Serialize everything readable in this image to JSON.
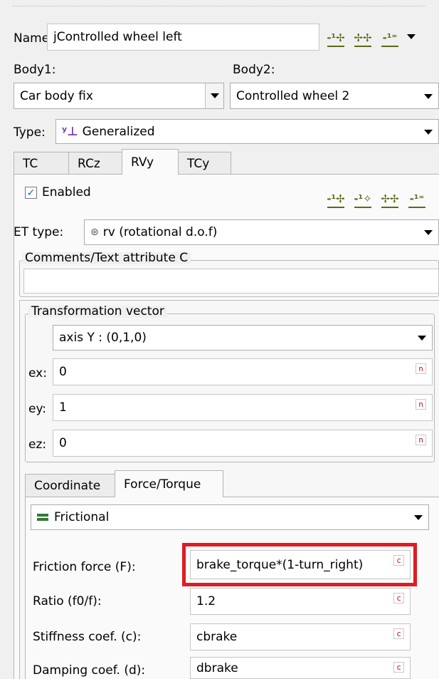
{
  "header": {
    "name_label": "Name",
    "name_value": "jControlled wheel left",
    "toolbar_icons": [
      "insert-before-icon",
      "insert-after-icon",
      "delete-icon",
      "more-chevron-icon"
    ]
  },
  "bodies": {
    "body1_label": "Body1:",
    "body1_value": "Car body fix",
    "body2_label": "Body2:",
    "body2_value": "Controlled wheel 2"
  },
  "type": {
    "label": "Type:",
    "value": "Generalized"
  },
  "tabs": [
    {
      "label": "TC",
      "active": false
    },
    {
      "label": "RCz",
      "active": false
    },
    {
      "label": "RVy",
      "active": true
    },
    {
      "label": "TCy",
      "active": false
    }
  ],
  "element": {
    "enabled_label": "Enabled",
    "enabled_checked": true,
    "et_type_label": "ET type:",
    "et_type_value": "rv (rotational d.o.f)",
    "comments_label": "Comments/Text attribute C",
    "comments_value": ""
  },
  "transformation": {
    "title": "Transformation vector",
    "axis_value": "axis Y : (0,1,0)",
    "rows": [
      {
        "label": "ex:",
        "value": "0"
      },
      {
        "label": "ey:",
        "value": "1"
      },
      {
        "label": "ez:",
        "value": "0"
      }
    ],
    "unit_glyph": "n"
  },
  "subtabs": [
    {
      "label": "Coordinate",
      "active": false
    },
    {
      "label": "Force/Torque",
      "active": true
    }
  ],
  "force": {
    "type_value": "Frictional",
    "param_glyph": "c",
    "params": [
      {
        "label": "Friction force (F):",
        "value": "brake_torque*(1-turn_right)",
        "highlighted": true
      },
      {
        "label": "Ratio (f0/f):",
        "value": "1.2",
        "highlighted": false
      },
      {
        "label": "Stiffness coef. (c):",
        "value": "cbrake",
        "highlighted": false
      },
      {
        "label": "Damping coef. (d):",
        "value": "dbrake",
        "highlighted": false
      }
    ]
  },
  "colors": {
    "highlight": "#e01b24",
    "icon_green": "#5a6a14",
    "param_glyph": "#d01010"
  }
}
